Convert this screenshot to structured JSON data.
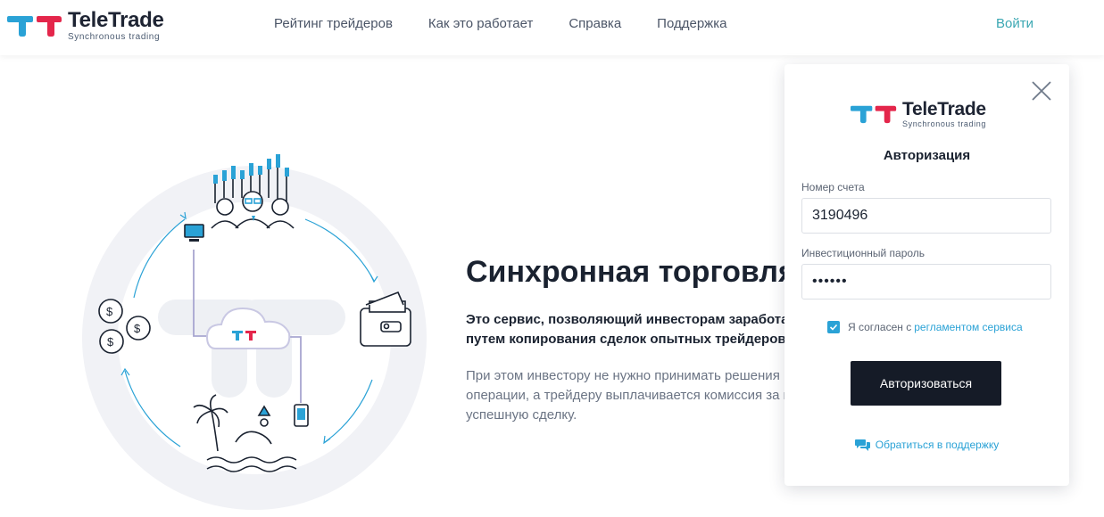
{
  "brand": {
    "name": "TeleTrade",
    "tagline": "Synchronous trading",
    "colors": {
      "accent_blue": "#2aa2d6",
      "accent_red": "#e4264b",
      "dark": "#151b27",
      "teal": "#3aa7b2"
    }
  },
  "header": {
    "nav": [
      {
        "label": "Рейтинг трейдеров"
      },
      {
        "label": "Как это работает"
      },
      {
        "label": "Справка"
      },
      {
        "label": "Поддержка"
      }
    ],
    "login_label": "Войти"
  },
  "hero": {
    "title": "Синхронная торговля",
    "lead": "Это сервис, позволяющий инвесторам заработать путем копирования сделок опытных трейдеров.",
    "sub": "При этом инвестору не нужно принимать решения по операции, а трейдеру выплачивается комиссия за каждую успешную сделку.",
    "icons": [
      "traders-icon",
      "wallet-icon",
      "beach-icon",
      "coins-icon",
      "cloud-logo-icon",
      "desktop-icon",
      "phone-icon"
    ]
  },
  "login": {
    "title": "Авторизация",
    "account_label": "Номер счета",
    "account_value": "3190496",
    "password_label": "Инвестиционный пароль",
    "password_value": "••••••",
    "agree_text": "Я согласен с",
    "agree_link": "регламентом сервиса",
    "agree_checked": true,
    "submit_label": "Авторизоваться",
    "support_label": "Обратиться в поддержку"
  }
}
